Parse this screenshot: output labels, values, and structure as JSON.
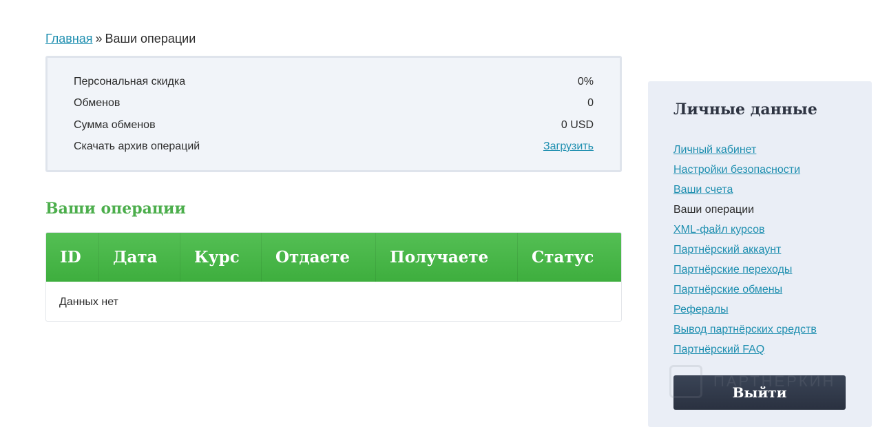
{
  "breadcrumb": {
    "home": "Главная",
    "separator": "»",
    "current": "Ваши операции"
  },
  "stats": [
    {
      "label": "Персональная скидка",
      "value": "0%"
    },
    {
      "label": "Обменов",
      "value": "0"
    },
    {
      "label": "Сумма обменов",
      "value": "0 USD"
    },
    {
      "label": "Скачать архив операций",
      "value": "Загрузить"
    }
  ],
  "section_title": "Ваши операции",
  "table": {
    "columns": [
      "ID",
      "Дата",
      "Курс",
      "Отдаете",
      "Получаете",
      "Статус"
    ],
    "empty_text": "Данных нет"
  },
  "sidebar": {
    "title": "Личные данные",
    "items": [
      {
        "label": "Личный кабинет"
      },
      {
        "label": "Настройки безопасности"
      },
      {
        "label": "Ваши счета"
      },
      {
        "label": "Ваши операции"
      },
      {
        "label": "XML-файл курсов"
      },
      {
        "label": "Партнёрский аккаунт"
      },
      {
        "label": "Партнёрские переходы"
      },
      {
        "label": "Партнёрские обмены"
      },
      {
        "label": "Рефералы"
      },
      {
        "label": "Вывод партнёрских средств"
      },
      {
        "label": "Партнёрский FAQ"
      }
    ],
    "logout_label": "Выйти"
  },
  "watermark": {
    "text": "ПАРТНЕРКИН"
  },
  "colors": {
    "accent_green": "#4cae4c",
    "link": "#1f8fb0",
    "dark_button": "#2e3442"
  }
}
